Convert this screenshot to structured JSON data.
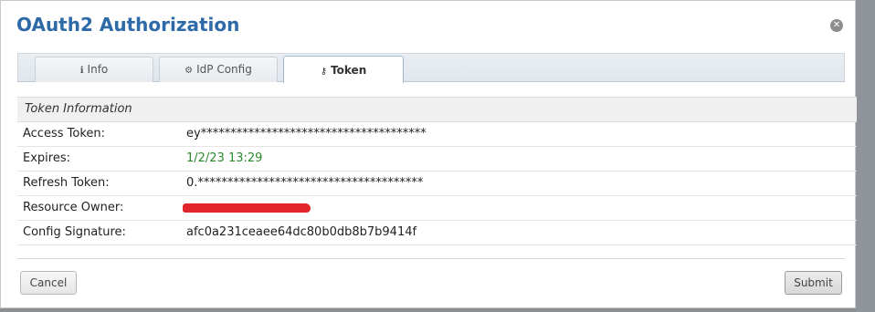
{
  "dialog": {
    "title": "OAuth2 Authorization",
    "close_icon": "close-circle-icon"
  },
  "tabs": [
    {
      "label": "Info",
      "icon": "info-icon",
      "active": false
    },
    {
      "label": "IdP Config",
      "icon": "gear-icon",
      "active": false
    },
    {
      "label": "Token",
      "icon": "key-icon",
      "active": true
    }
  ],
  "token_info": {
    "header": "Token Information",
    "rows": [
      {
        "label": "Access Token:",
        "value": "ey**************************************"
      },
      {
        "label": "Expires:",
        "value": "1/2/23 13:29"
      },
      {
        "label": "Refresh Token:",
        "value": "0.**************************************"
      },
      {
        "label": "Resource Owner:",
        "value": ""
      },
      {
        "label": "Config Signature:",
        "value": "afc0a231ceaee64dc80b0db8b7b9414f"
      }
    ]
  },
  "buttons": {
    "cancel": "Cancel",
    "submit": "Submit"
  },
  "colors": {
    "title": "#2e6aa8",
    "expires_value": "#2b8a2b",
    "redaction": "#e0262a"
  }
}
